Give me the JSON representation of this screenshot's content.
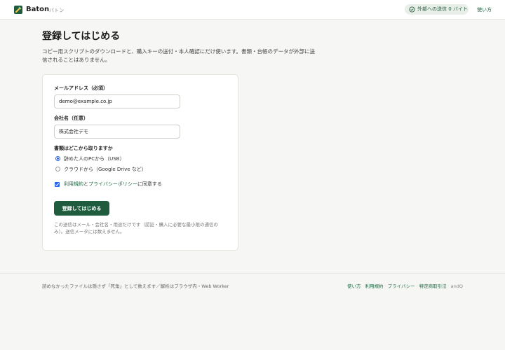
{
  "header": {
    "brand": "Baton",
    "brand_sub": "バトン",
    "badge": "外部への送信 0 バイト",
    "help": "使い方"
  },
  "main": {
    "title": "登録してはじめる",
    "lead": "コピー用スクリプトのダウンロードと、購入キーの送付・本人確認にだけ使います。書類・台帳のデータが外部に送信されることはありません。"
  },
  "form": {
    "email_label": "メールアドレス（必須）",
    "email_value": "demo@example.co.jp",
    "company_label": "会社名（任意）",
    "company_value": "株式会社デモ",
    "source_label": "書類はどこから取りますか",
    "options": [
      {
        "label": "辞めた人のPCから（USB）",
        "checked": true
      },
      {
        "label": "クラウドから（Google Drive など）",
        "checked": false
      }
    ],
    "agree_terms": "利用規約",
    "agree_and": "と",
    "agree_privacy": "プライバシーポリシー",
    "agree_suffix": "に同意する",
    "submit": "登録してはじめる",
    "note": "この送信はメール・会社名・用途だけです（認証・購入に必要な最小限の通信のみ）。送信メータには数えません。"
  },
  "footer": {
    "left": "読めなかったファイルは隠さず「死角」として数えます／解析はブラウザ内・Web Worker",
    "links": [
      "使い方",
      "利用規約",
      "プライバシー",
      "特定商取引法"
    ],
    "sep": "·",
    "brand": "andQ"
  },
  "colors": {
    "accent": "#1f5c3d",
    "link": "#1f6b45",
    "badge_bg": "#e7efe8",
    "check": "#2563eb"
  }
}
